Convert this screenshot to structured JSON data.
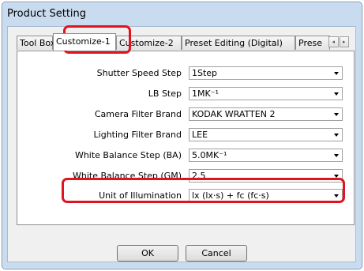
{
  "window": {
    "title": "Product Setting"
  },
  "tabs": [
    {
      "label": "Tool Box",
      "active": false
    },
    {
      "label": "Customize-1",
      "active": true
    },
    {
      "label": "Customize-2",
      "active": false
    },
    {
      "label": "Preset Editing (Digital)",
      "active": false
    },
    {
      "label": "Prese",
      "active": false
    }
  ],
  "tab_scroll": {
    "left_glyph": "◂",
    "right_glyph": "▸"
  },
  "settings": [
    {
      "label": "Shutter Speed Step",
      "value": "1Step"
    },
    {
      "label": "LB Step",
      "value": "1MK⁻¹"
    },
    {
      "label": "Camera Filter Brand",
      "value": "KODAK WRATTEN 2"
    },
    {
      "label": "Lighting Filter Brand",
      "value": "LEE"
    },
    {
      "label": "White Balance Step (BA)",
      "value": "5.0MK⁻¹"
    },
    {
      "label": "White Balance Step (GM)",
      "value": "2.5"
    },
    {
      "label": "Unit of Illumination",
      "value": "lx (lx·s) + fc (fc·s)"
    }
  ],
  "buttons": {
    "ok": "OK",
    "cancel": "Cancel"
  },
  "colors": {
    "highlight": "#e0141e"
  }
}
